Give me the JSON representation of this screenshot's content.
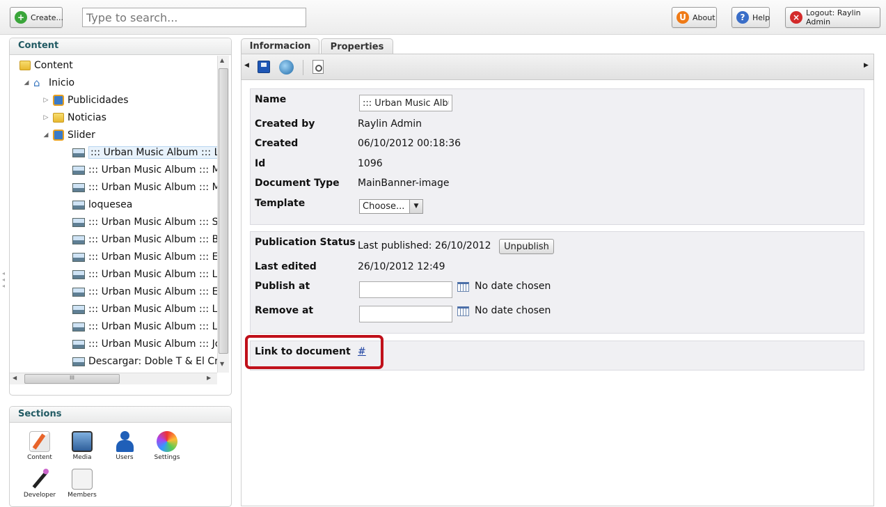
{
  "topbar": {
    "create_label": "Create...",
    "search_placeholder": "Type to search...",
    "about_label": "About",
    "help_label": "Help",
    "logout_label": "Logout: Raylin Admin"
  },
  "content_panel": {
    "title": "Content",
    "tree": [
      {
        "label": "Content"
      },
      {
        "label": "Inicio"
      },
      {
        "label": "Publicidades"
      },
      {
        "label": "Noticias"
      },
      {
        "label": "Slider"
      },
      {
        "label": "::: Urban Music Album ::: Lap"
      },
      {
        "label": "::: Urban Music Album ::: Mor"
      },
      {
        "label": "::: Urban Music Album ::: Milk"
      },
      {
        "label": "loquesea"
      },
      {
        "label": "::: Urban Music Album ::: Sec"
      },
      {
        "label": "::: Urban Music Album ::: Bla"
      },
      {
        "label": "::: Urban Music Album ::: El F"
      },
      {
        "label": "::: Urban Music Album ::: Los"
      },
      {
        "label": "::: Urban Music Album ::: El F"
      },
      {
        "label": "::: Urban Music Album ::: La I"
      },
      {
        "label": "::: Urban Music Album ::: Los"
      },
      {
        "label": "::: Urban Music Album ::: Jou"
      },
      {
        "label": "Descargar: Doble T & El Cro"
      }
    ],
    "hscroll_grip": "III"
  },
  "sections_panel": {
    "title": "Sections",
    "items": [
      {
        "label": "Content",
        "icon": "pencil-paper-icon"
      },
      {
        "label": "Media",
        "icon": "monitor-image-icon"
      },
      {
        "label": "Users",
        "icon": "user-icon"
      },
      {
        "label": "Settings",
        "icon": "color-wheel-icon"
      },
      {
        "label": "Developer",
        "icon": "magic-wand-icon"
      },
      {
        "label": "Members",
        "icon": "id-card-icon"
      }
    ]
  },
  "tabs": [
    {
      "label": "Informacion"
    },
    {
      "label": "Properties"
    }
  ],
  "properties": {
    "name_label": "Name",
    "name_value": "::: Urban Music Album",
    "created_by_label": "Created by",
    "created_by_value": "Raylin Admin",
    "created_label": "Created",
    "created_value": "06/10/2012 00:18:36",
    "id_label": "Id",
    "id_value": "1096",
    "doctype_label": "Document Type",
    "doctype_value": "MainBanner-image",
    "template_label": "Template",
    "template_value": "Choose..."
  },
  "publication": {
    "status_label": "Publication Status",
    "last_published": "Last published: 26/10/2012",
    "unpublish_label": "Unpublish",
    "last_edited_label": "Last edited",
    "last_edited_value": "26/10/2012 12:49",
    "publish_at_label": "Publish at",
    "publish_at_note": "No date chosen",
    "remove_at_label": "Remove at",
    "remove_at_note": "No date chosen"
  },
  "link": {
    "label": "Link to document",
    "value": "#"
  },
  "colors": {
    "highlight": "#c0101a",
    "panel_title": "#215a63",
    "accent_green": "#3aa53a"
  }
}
